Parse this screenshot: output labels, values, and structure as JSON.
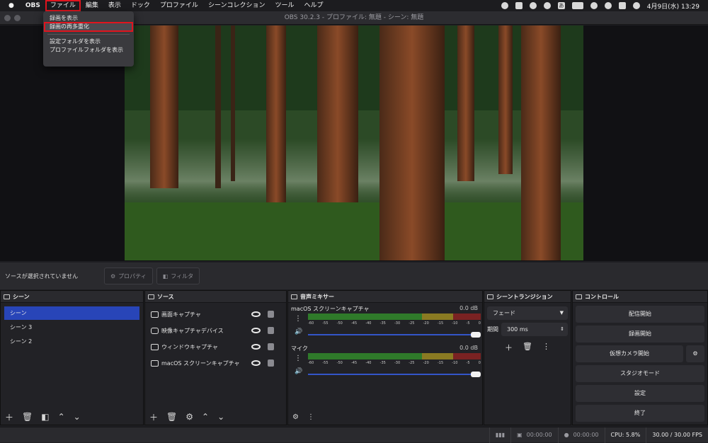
{
  "menubar": {
    "items": [
      "OBS",
      "ファイル",
      "編集",
      "表示",
      "ドック",
      "プロファイル",
      "シーンコレクション",
      "ツール",
      "ヘルプ"
    ],
    "clock": "4月9日(水) 13:29",
    "input_method": "あ"
  },
  "window": {
    "title": "OBS 30.2.3 - プロファイル: 無題 - シーン: 無題"
  },
  "file_menu": {
    "items": [
      "録画を表示",
      "録画の再多重化",
      "設定フォルダを表示",
      "プロファイルフォルダを表示"
    ]
  },
  "source_bar": {
    "no_selection": "ソースが選択されていません",
    "properties": "プロパティ",
    "filters": "フィルタ"
  },
  "scenes": {
    "title": "シーン",
    "items": [
      "シーン",
      "シーン 3",
      "シーン 2"
    ]
  },
  "sources": {
    "title": "ソース",
    "items": [
      "画面キャプチャ",
      "映像キャプチャデバイス",
      "ウィンドウキャプチャ",
      "macOS スクリーンキャプチャ"
    ]
  },
  "mixer": {
    "title": "音声ミキサー",
    "ticks": [
      "-60",
      "-55",
      "-50",
      "-45",
      "-40",
      "-35",
      "-30",
      "-25",
      "-20",
      "-15",
      "-10",
      "-5",
      "0"
    ],
    "channels": [
      {
        "name": "macOS スクリーンキャプチャ",
        "db": "0.0 dB",
        "volume": 1.0
      },
      {
        "name": "マイク",
        "db": "0.0 dB",
        "volume": 1.0
      }
    ]
  },
  "transitions": {
    "title": "シーントランジション",
    "type": "フェード",
    "duration_label": "期間",
    "duration": "300 ms"
  },
  "controls": {
    "title": "コントロール",
    "stream": "配信開始",
    "record": "録画開始",
    "virtual_cam": "仮想カメラ開始",
    "studio": "スタジオモード",
    "settings": "設定",
    "exit": "終了"
  },
  "status": {
    "rec_time": "00:00:00",
    "stream_time": "00:00:00",
    "cpu": "CPU: 5.8%",
    "fps": "30.00 / 30.00 FPS"
  },
  "colors": {
    "accent": "#2845b8",
    "highlight": "#e0141e"
  }
}
